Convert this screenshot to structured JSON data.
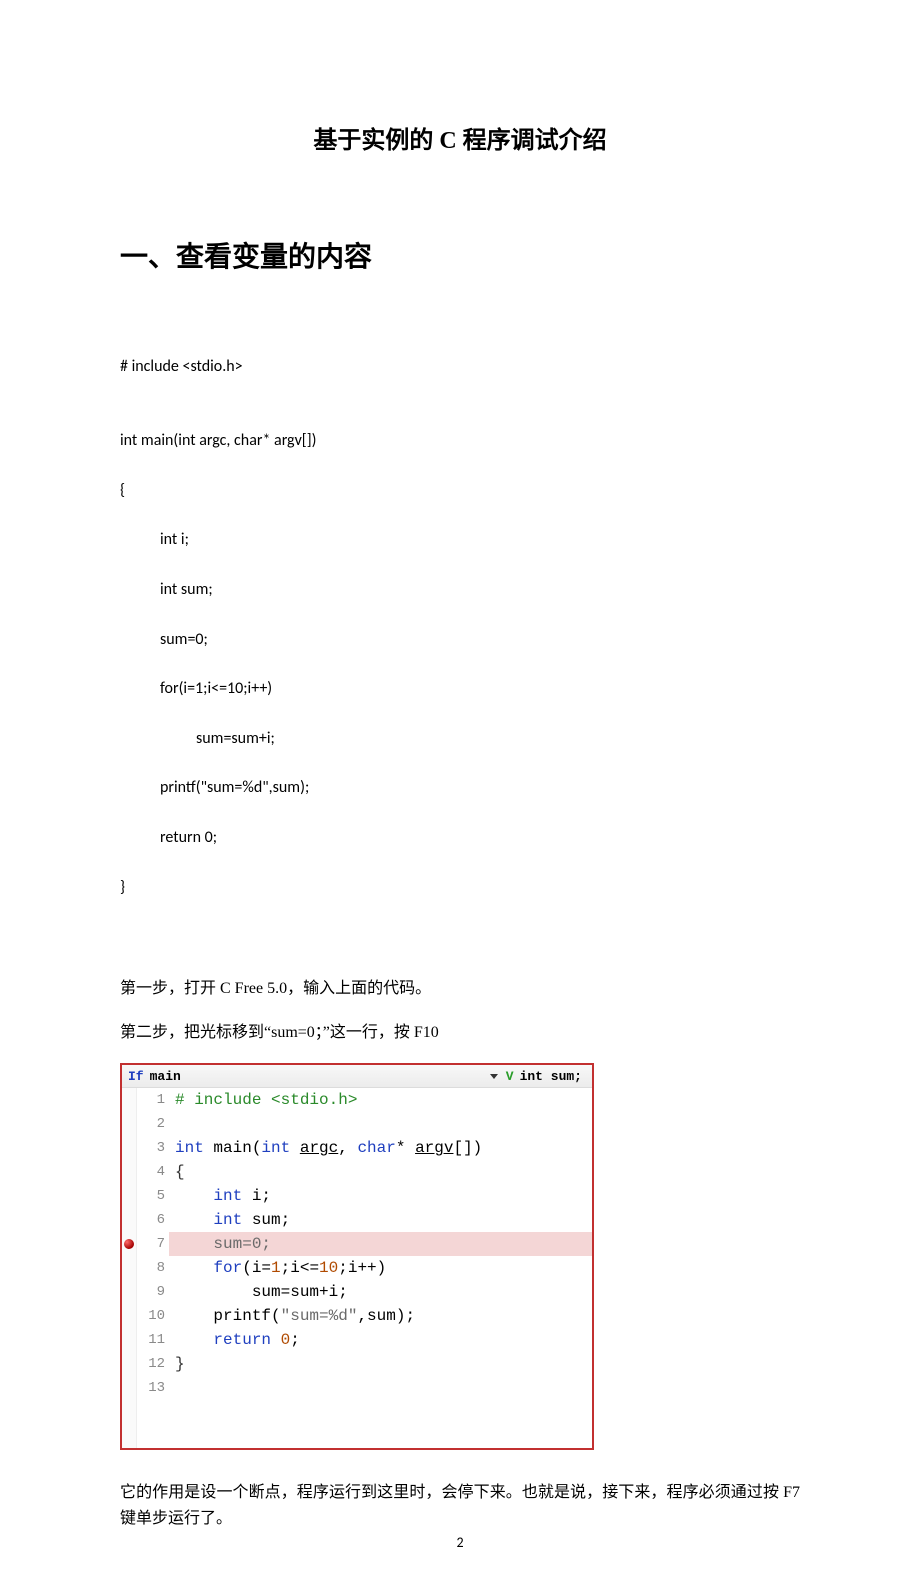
{
  "page": {
    "title": "基于实例的 C 程序调试介绍",
    "section1": "一、查看变量的内容",
    "code_lines": [
      "# include <stdio.h>",
      "",
      "int main(int argc, char* argv[])",
      "{",
      "int i;",
      "int sum;",
      "sum=0;",
      "for(i=1;i<=10;i++)",
      "sum=sum+i;",
      "printf(\"sum=%d\",sum);",
      "return 0;",
      "}"
    ],
    "step1": "第一步，打开 C Free 5.0，输入上面的代码。",
    "step2": "第二步，把光标移到“sum=0；”这一行，按 F10",
    "explain": "它的作用是设一个断点，程序运行到这里时，会停下来。也就是说，接下来，程序必须通过按 F7 键单步运行了。",
    "page_number": "2"
  },
  "editor": {
    "top_fn_kw": "If",
    "top_fn_name": "main",
    "top_var_icon": "V",
    "top_var_text": "int sum;",
    "breakpoint_line": 7,
    "lines": [
      {
        "n": "1",
        "hl": false,
        "html": "<span class='tok-pp'># include &lt;stdio.h&gt;</span>"
      },
      {
        "n": "2",
        "hl": false,
        "html": ""
      },
      {
        "n": "3",
        "hl": false,
        "html": "<span class='tok-tp'>int</span> main(<span class='tok-tp'>int</span> <span class='tok-ud'>argc</span>, <span class='tok-tp'>char</span>* <span class='tok-ud'>argv</span>[])"
      },
      {
        "n": "4",
        "hl": false,
        "html": "<span class='tok-br'>{</span>"
      },
      {
        "n": "5",
        "hl": false,
        "html": "    <span class='tok-tp'>int</span> i;"
      },
      {
        "n": "6",
        "hl": false,
        "html": "    <span class='tok-tp'>int</span> sum;"
      },
      {
        "n": "7",
        "hl": true,
        "html": "    <span class='tok-ed'>sum=</span><span class='tok-ed'>0</span><span class='tok-ed'>;</span>"
      },
      {
        "n": "8",
        "hl": false,
        "html": "    <span class='tok-kw'>for</span>(i=<span class='tok-num'>1</span>;i&lt;=<span class='tok-num'>10</span>;i++)"
      },
      {
        "n": "9",
        "hl": false,
        "html": "        sum=sum+i;"
      },
      {
        "n": "10",
        "hl": false,
        "html": "    printf(<span class='tok-str'>\"sum=%d\"</span>,sum);"
      },
      {
        "n": "11",
        "hl": false,
        "html": "    <span class='tok-kw'>return</span> <span class='tok-num'>0</span>;"
      },
      {
        "n": "12",
        "hl": false,
        "html": "<span class='tok-br'>}</span>"
      },
      {
        "n": "13",
        "hl": false,
        "html": ""
      }
    ]
  }
}
